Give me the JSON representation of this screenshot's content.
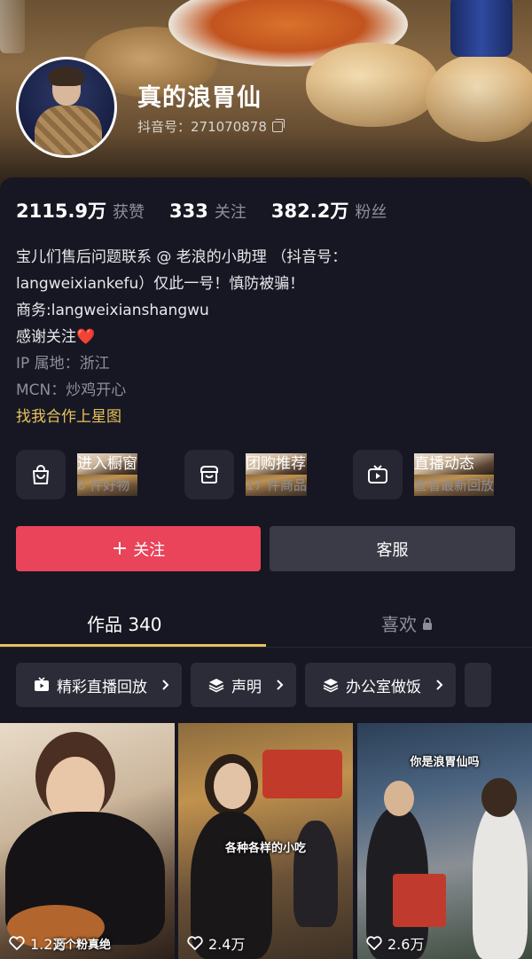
{
  "profile": {
    "name": "真的浪胃仙",
    "douyin_id": "抖音号：271070878"
  },
  "stats": [
    {
      "value": "2115.9万",
      "label": "获赞"
    },
    {
      "value": "333",
      "label": "关注"
    },
    {
      "value": "382.2万",
      "label": "粉丝"
    }
  ],
  "bio": {
    "line1": "宝儿们售后问题联系 @ 老浪的小助理 （抖音号：",
    "line2": "langweixiankefu）仅此一号！慎防被骗！",
    "line3": "商务:langweixianshangwu",
    "line4": "感谢关注",
    "heart": "❤️",
    "ip": "IP 属地：浙江",
    "mcn": "MCN：炒鸡开心",
    "cooperate": "找我合作上星图"
  },
  "entries": [
    {
      "icon": "shopping-bag-icon",
      "title": "进入橱窗",
      "subtitle": "0 件好物"
    },
    {
      "icon": "group-buy-icon",
      "title": "团购推荐",
      "subtitle": "17 件商品"
    },
    {
      "icon": "live-tv-icon",
      "title": "直播动态",
      "subtitle": "查看最新回放"
    }
  ],
  "buttons": {
    "follow": "关注",
    "follow_plus": "+",
    "service": "客服"
  },
  "tabs": {
    "works": "作品 340",
    "likes": "喜欢"
  },
  "collections": [
    {
      "icon": "live-replay-icon",
      "label": "精彩直播回放"
    },
    {
      "icon": "stack-icon",
      "label": "声明"
    },
    {
      "icon": "stack-icon",
      "label": "办公室做饭"
    }
  ],
  "videos": [
    {
      "likes": "1.2万",
      "caption": "这个粉真绝"
    },
    {
      "likes": "2.4万",
      "caption": "各种各样的小吃"
    },
    {
      "likes": "2.6万",
      "caption": "你是浪胃仙吗"
    }
  ],
  "colors": {
    "accent_follow": "#e9445a",
    "gold": "#e7c25c",
    "background": "#161722"
  }
}
